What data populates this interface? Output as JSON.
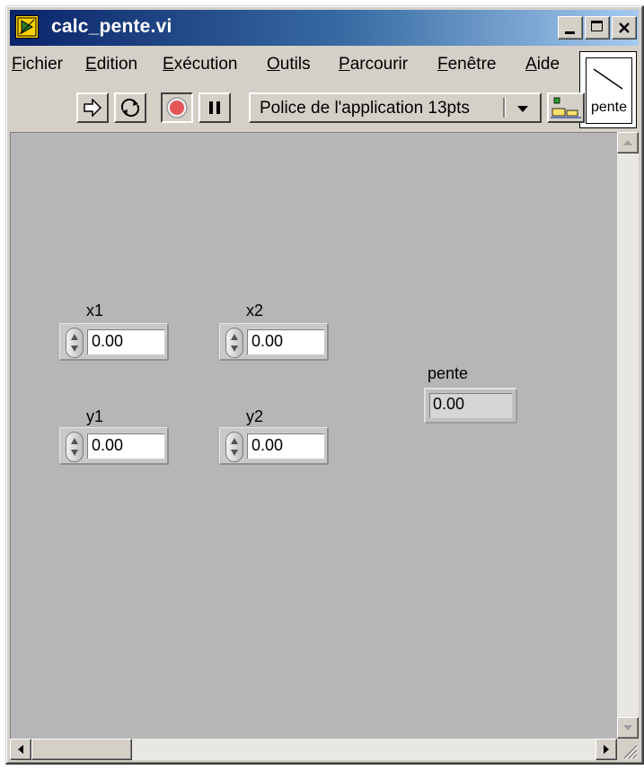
{
  "window": {
    "title": "calc_pente.vi"
  },
  "menu": {
    "items": [
      {
        "accel": "F",
        "rest": "ichier"
      },
      {
        "accel": "E",
        "rest": "dition"
      },
      {
        "accel": "E",
        "rest": "xécution",
        "accel_display": "E"
      },
      {
        "accel": "O",
        "rest": "utils"
      },
      {
        "accel": "P",
        "rest": "arcourir"
      },
      {
        "accel": "F",
        "rest": "enêtre"
      },
      {
        "accel": "A",
        "rest": "ide"
      }
    ]
  },
  "toolbar": {
    "font": "Police de l'application 13pts"
  },
  "icon_pane": {
    "label": "pente"
  },
  "controls": {
    "x1": {
      "label": "x1",
      "value": "0.00"
    },
    "x2": {
      "label": "x2",
      "value": "0.00"
    },
    "y1": {
      "label": "y1",
      "value": "0.00"
    },
    "y2": {
      "label": "y2",
      "value": "0.00"
    }
  },
  "indicator": {
    "label": "pente",
    "value": "0.00"
  },
  "colors": {
    "titlebar_start": "#0a246a",
    "titlebar_end": "#a6caf0",
    "panel": "#b6b6b6",
    "stop": "#e35555"
  }
}
